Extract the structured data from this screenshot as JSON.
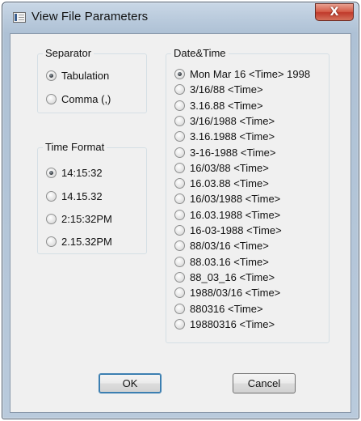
{
  "window": {
    "title": "View File Parameters",
    "close_glyph": "X"
  },
  "separator": {
    "legend": "Separator",
    "options": [
      {
        "label": "Tabulation",
        "checked": true
      },
      {
        "label": "Comma (,)",
        "checked": false
      }
    ]
  },
  "time_format": {
    "legend": "Time Format",
    "options": [
      {
        "label": "14:15:32",
        "checked": true
      },
      {
        "label": "14.15.32",
        "checked": false
      },
      {
        "label": "2:15:32PM",
        "checked": false
      },
      {
        "label": "2.15.32PM",
        "checked": false
      }
    ]
  },
  "date_time": {
    "legend": "Date&Time",
    "options": [
      {
        "label": "Mon Mar 16 <Time> 1998",
        "checked": true
      },
      {
        "label": "3/16/88  <Time>",
        "checked": false
      },
      {
        "label": "3.16.88  <Time>",
        "checked": false
      },
      {
        "label": "3/16/1988  <Time>",
        "checked": false
      },
      {
        "label": "3.16.1988  <Time>",
        "checked": false
      },
      {
        "label": "3-16-1988  <Time>",
        "checked": false
      },
      {
        "label": "16/03/88  <Time>",
        "checked": false
      },
      {
        "label": "16.03.88  <Time>",
        "checked": false
      },
      {
        "label": "16/03/1988  <Time>",
        "checked": false
      },
      {
        "label": "16.03.1988  <Time>",
        "checked": false
      },
      {
        "label": "16-03-1988  <Time>",
        "checked": false
      },
      {
        "label": "88/03/16  <Time>",
        "checked": false
      },
      {
        "label": "88.03.16  <Time>",
        "checked": false
      },
      {
        "label": "88_03_16  <Time>",
        "checked": false
      },
      {
        "label": "1988/03/16  <Time>",
        "checked": false
      },
      {
        "label": "880316  <Time>",
        "checked": false
      },
      {
        "label": "19880316  <Time>",
        "checked": false
      }
    ]
  },
  "buttons": {
    "ok": "OK",
    "cancel": "Cancel"
  }
}
